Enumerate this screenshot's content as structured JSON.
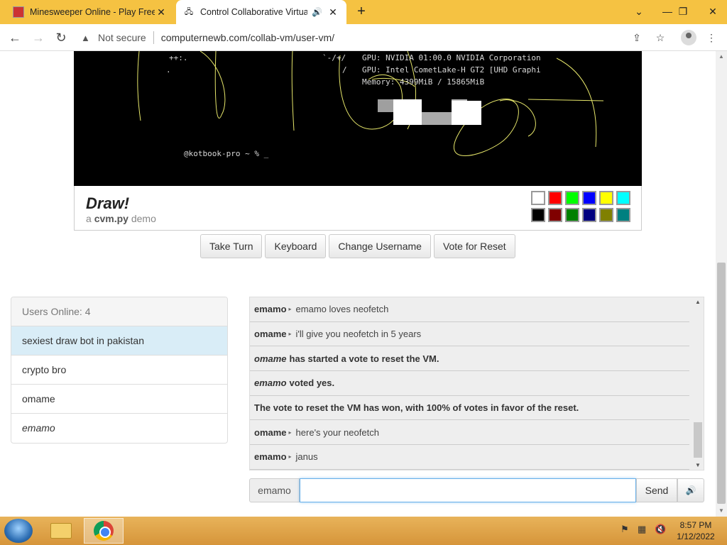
{
  "browser": {
    "tabs": [
      {
        "title": "Minesweeper Online - Play Free Online Minesweeper",
        "active": false
      },
      {
        "title": "Control Collaborative Virtual Machines",
        "active": true
      }
    ],
    "security_label": "Not secure",
    "url": "computernewb.com/collab-vm/user-vm/"
  },
  "vm": {
    "terminal_lines": [
      "GPU: NVIDIA 01:00.0 NVIDIA Corporation",
      "GPU: Intel CometLake-H GT2 [UHD Graphi",
      "Memory: 4399MiB / 15865MiB"
    ],
    "ascii_a": "++:.",
    "ascii_b": "`-/+/",
    "ascii_c": "/",
    "ascii_d": ".",
    "prompt": "@kotbook-pro ~ % _",
    "draw_title": "Draw!",
    "subtitle_prefix": "a",
    "subtitle_name": "cvm.py",
    "subtitle_suffix": "demo",
    "palette": [
      "#ffffff",
      "#ff0000",
      "#00ff00",
      "#0000ff",
      "#ffff00",
      "#00ffff",
      "#000000",
      "#800000",
      "#008000",
      "#000080",
      "#808000",
      "#008080"
    ],
    "buttons": [
      "Take Turn",
      "Keyboard",
      "Change Username",
      "Vote for Reset"
    ]
  },
  "users": {
    "header": "Users Online: 4",
    "list": [
      {
        "name": "sexiest draw bot in pakistan",
        "selected": true
      },
      {
        "name": "crypto bro"
      },
      {
        "name": "omame"
      },
      {
        "name": "emamo",
        "self": true
      }
    ]
  },
  "chat": {
    "messages": [
      {
        "type": "user",
        "name": "emamo",
        "text": "emamo loves neofetch"
      },
      {
        "type": "user",
        "name": "omame",
        "text": "i'll give you neofetch in 5 years"
      },
      {
        "type": "system",
        "name": "omame",
        "text": "has started a vote to reset the VM."
      },
      {
        "type": "system",
        "name": "emamo",
        "text": "voted yes."
      },
      {
        "type": "system",
        "name": "",
        "text": "The vote to reset the VM has won, with 100% of votes in favor of the reset."
      },
      {
        "type": "user",
        "name": "omame",
        "text": "here's your neofetch"
      },
      {
        "type": "user",
        "name": "emamo",
        "text": "janus"
      }
    ],
    "username_label": "emamo",
    "input_value": "",
    "send_label": "Send"
  },
  "taskbar": {
    "time": "8:57 PM",
    "date": "1/12/2022"
  }
}
